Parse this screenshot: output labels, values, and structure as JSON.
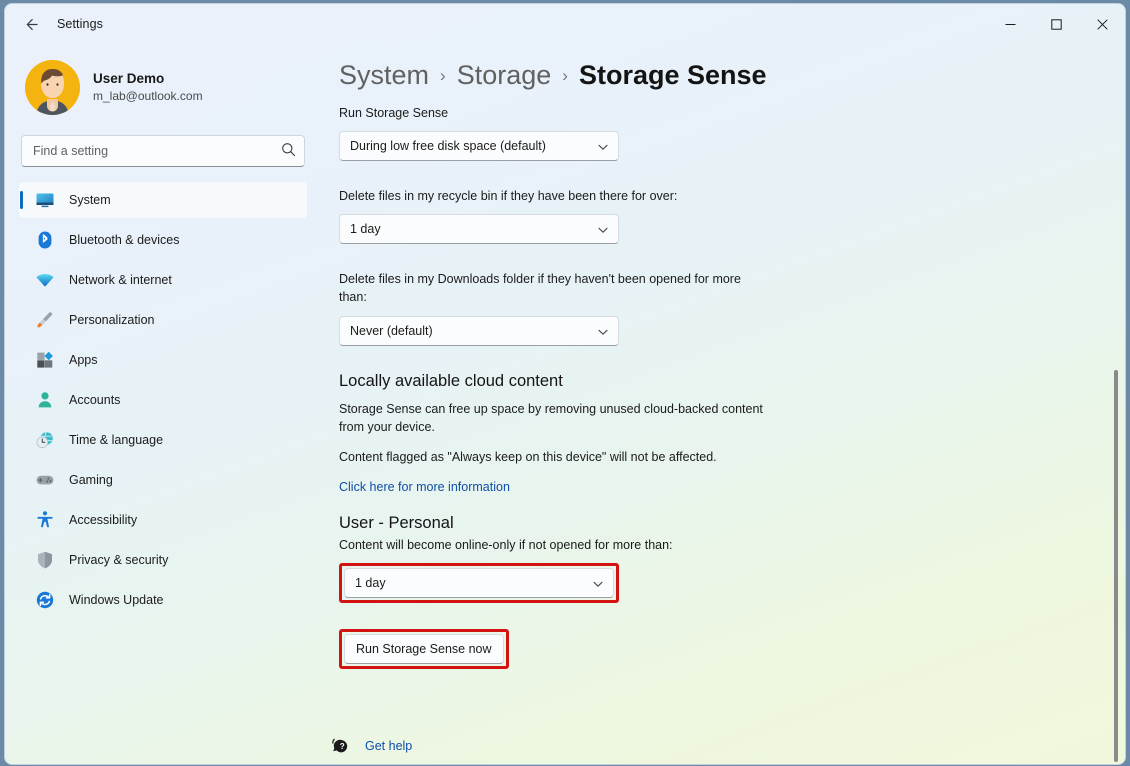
{
  "window": {
    "title": "Settings",
    "back_icon": "back-arrow-icon",
    "minimize_icon": "minimize-icon",
    "maximize_icon": "maximize-icon",
    "close_icon": "close-icon"
  },
  "account": {
    "name": "User Demo",
    "email": "m_lab@outlook.com",
    "avatar_icon": "user-avatar"
  },
  "search": {
    "placeholder": "Find a setting",
    "value": "",
    "icon": "search-icon"
  },
  "sidebar": {
    "items": [
      {
        "label": "System",
        "icon": "monitor-icon",
        "selected": true
      },
      {
        "label": "Bluetooth & devices",
        "icon": "bluetooth-icon",
        "selected": false
      },
      {
        "label": "Network & internet",
        "icon": "wifi-icon",
        "selected": false
      },
      {
        "label": "Personalization",
        "icon": "brush-icon",
        "selected": false
      },
      {
        "label": "Apps",
        "icon": "apps-icon",
        "selected": false
      },
      {
        "label": "Accounts",
        "icon": "person-icon",
        "selected": false
      },
      {
        "label": "Time & language",
        "icon": "clock-globe-icon",
        "selected": false
      },
      {
        "label": "Gaming",
        "icon": "gamepad-icon",
        "selected": false
      },
      {
        "label": "Accessibility",
        "icon": "accessibility-icon",
        "selected": false
      },
      {
        "label": "Privacy & security",
        "icon": "shield-icon",
        "selected": false
      },
      {
        "label": "Windows Update",
        "icon": "update-icon",
        "selected": false
      }
    ]
  },
  "breadcrumb": {
    "items": [
      "System",
      "Storage",
      "Storage Sense"
    ],
    "separator": "›"
  },
  "main": {
    "run_storage_sense": {
      "label": "Run Storage Sense",
      "value": "During low free disk space (default)"
    },
    "recycle_bin": {
      "label": "Delete files in my recycle bin if they have been there for over:",
      "value": "1 day"
    },
    "downloads": {
      "label": "Delete files in my Downloads folder if they haven't been opened for more than:",
      "value": "Never (default)"
    },
    "cloud_content": {
      "heading": "Locally available cloud content",
      "paragraph1": "Storage Sense can free up space by removing unused cloud-backed content from your device.",
      "paragraph2": "Content flagged as \"Always keep on this device\" will not be affected.",
      "link": "Click here for more information"
    },
    "user_personal": {
      "heading": "User - Personal",
      "label": "Content will become online-only if not opened for more than:",
      "value": "1 day",
      "highlighted": true
    },
    "run_now_button": {
      "label": "Run Storage Sense now",
      "highlighted": true
    }
  },
  "footer": {
    "get_help_label": "Get help",
    "get_help_icon": "help-bubble-icon"
  },
  "colors": {
    "accent": "#0f6cbd",
    "link": "#0f4fa8",
    "highlight_border": "#d31212",
    "bg_top": "#eaf1fa",
    "bg_bottom": "#f0f8dc"
  }
}
